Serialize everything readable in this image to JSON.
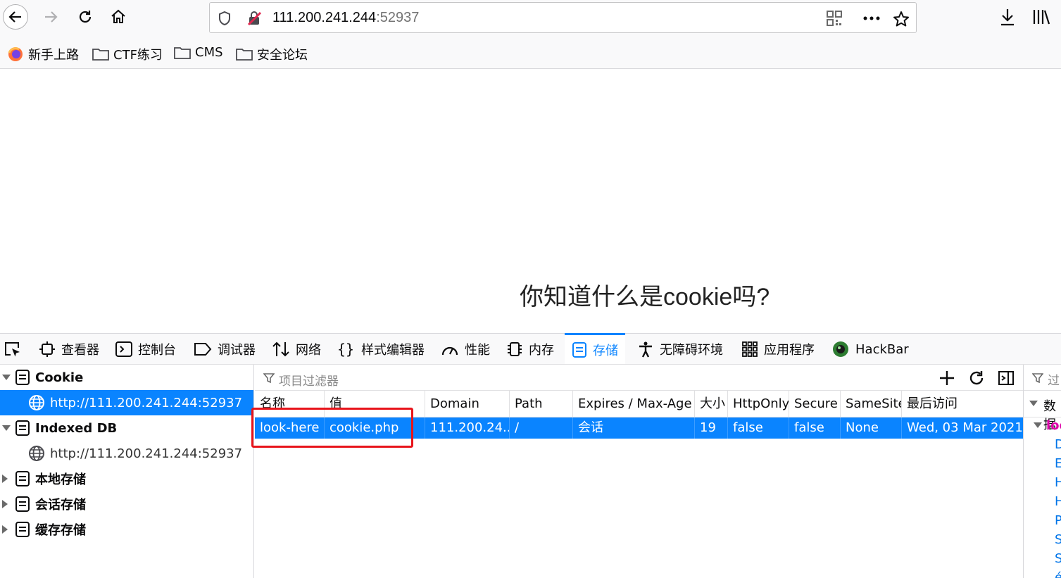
{
  "browser": {
    "url_host": "111.200.241.244",
    "url_port": ":52937",
    "bookmarks": [
      "新手上路",
      "CTF练习",
      "CMS",
      "安全论坛"
    ]
  },
  "page": {
    "heading": "你知道什么是cookie吗?"
  },
  "devtools": {
    "tabs": [
      "查看器",
      "控制台",
      "调试器",
      "网络",
      "样式编辑器",
      "性能",
      "内存",
      "存储",
      "无障碍环境",
      "应用程序",
      "HackBar"
    ],
    "active_tab": "存储",
    "tree": {
      "cookie_label": "Cookie",
      "cookie_host": "http://111.200.241.244:52937",
      "indexeddb_label": "Indexed DB",
      "indexeddb_host": "http://111.200.241.244:52937",
      "local_storage": "本地存储",
      "session_storage": "会话存储",
      "cache_storage": "缓存存储"
    },
    "filter_placeholder": "项目过滤器",
    "columns": [
      "名称",
      "值",
      "Domain",
      "Path",
      "Expires / Max-Age",
      "大小",
      "HttpOnly",
      "Secure",
      "SameSite",
      "最后访问"
    ],
    "rows": [
      {
        "name": "look-here",
        "value": "cookie.php",
        "domain": "111.200.24...",
        "path": "/",
        "expires": "会话",
        "size": "19",
        "httponly": "false",
        "secure": "false",
        "samesite": "None",
        "last_accessed": "Wed, 03 Mar 2021..."
      }
    ],
    "sidepanel": {
      "filter": "过",
      "head": "数据",
      "section": "loo",
      "items": [
        "D",
        "E",
        "H",
        "H",
        "P",
        "S",
        "S",
        "é"
      ]
    }
  },
  "colors": {
    "accent": "#0a84ff",
    "highlight_box": "#e8141b"
  }
}
